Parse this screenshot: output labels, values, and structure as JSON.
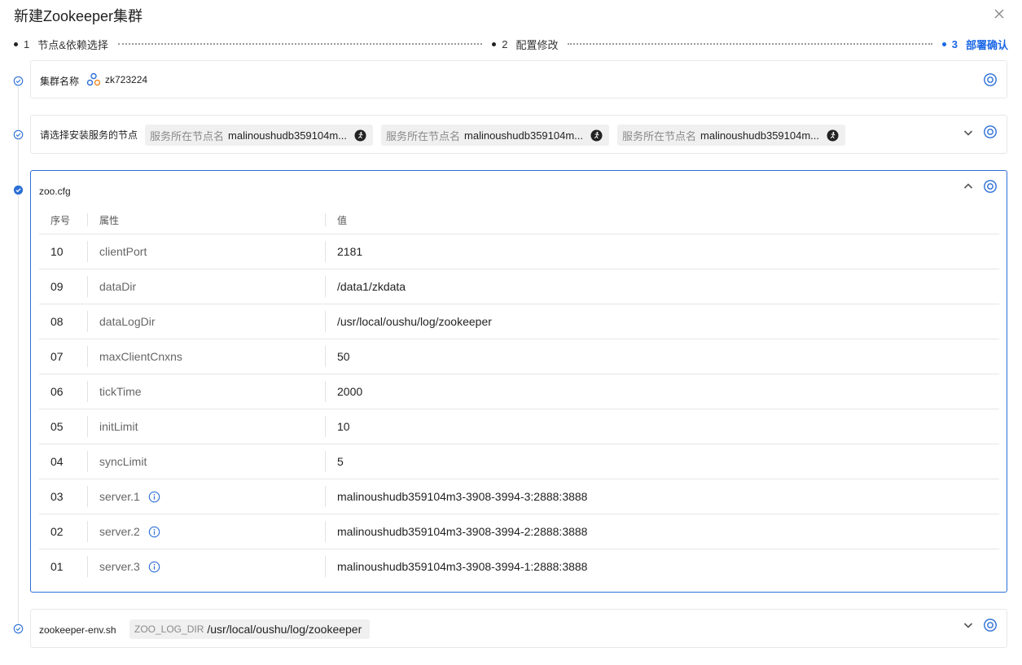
{
  "dialog": {
    "title": "新建Zookeeper集群"
  },
  "steps": [
    {
      "num": "1",
      "label": "节点&依赖选择",
      "active": false
    },
    {
      "num": "2",
      "label": "配置修改",
      "active": false
    },
    {
      "num": "3",
      "label": "部署确认",
      "active": true
    }
  ],
  "cluster": {
    "label": "集群名称",
    "name": "zk723224"
  },
  "nodes": {
    "label": "请选择安装服务的节点",
    "tags": [
      {
        "key": "服务所在节点名",
        "value": "malinoushudb359104m..."
      },
      {
        "key": "服务所在节点名",
        "value": "malinoushudb359104m..."
      },
      {
        "key": "服务所在节点名",
        "value": "malinoushudb359104m..."
      }
    ]
  },
  "zoo_cfg": {
    "label": "zoo.cfg",
    "columns": {
      "index": "序号",
      "property": "属性",
      "value": "值"
    },
    "rows": [
      {
        "index": "10",
        "property": "clientPort",
        "value": "2181",
        "info": false
      },
      {
        "index": "09",
        "property": "dataDir",
        "value": "/data1/zkdata",
        "info": false
      },
      {
        "index": "08",
        "property": "dataLogDir",
        "value": "/usr/local/oushu/log/zookeeper",
        "info": false
      },
      {
        "index": "07",
        "property": "maxClientCnxns",
        "value": "50",
        "info": false
      },
      {
        "index": "06",
        "property": "tickTime",
        "value": "2000",
        "info": false
      },
      {
        "index": "05",
        "property": "initLimit",
        "value": "10",
        "info": false
      },
      {
        "index": "04",
        "property": "syncLimit",
        "value": "5",
        "info": false
      },
      {
        "index": "03",
        "property": "server.1",
        "value": "malinoushudb359104m3-3908-3994-3:2888:3888",
        "info": true
      },
      {
        "index": "02",
        "property": "server.2",
        "value": "malinoushudb359104m3-3908-3994-2:2888:3888",
        "info": true
      },
      {
        "index": "01",
        "property": "server.3",
        "value": "malinoushudb359104m3-3908-3994-1:2888:3888",
        "info": true
      }
    ]
  },
  "env": {
    "label": "zookeeper-env.sh",
    "tag": {
      "key": "ZOO_LOG_DIR",
      "value": "/usr/local/oushu/log/zookeeper"
    }
  },
  "colors": {
    "accent": "#1a66e6",
    "check": "#2c6fd6"
  },
  "icons": {
    "close": "close-icon",
    "settings": "settings-icon",
    "chevron_down": "chevron-down-icon",
    "chevron_up": "chevron-up-icon",
    "check_circle": "check-circle-icon",
    "info": "info-icon",
    "run": "run-icon",
    "cluster": "cluster-icon"
  }
}
